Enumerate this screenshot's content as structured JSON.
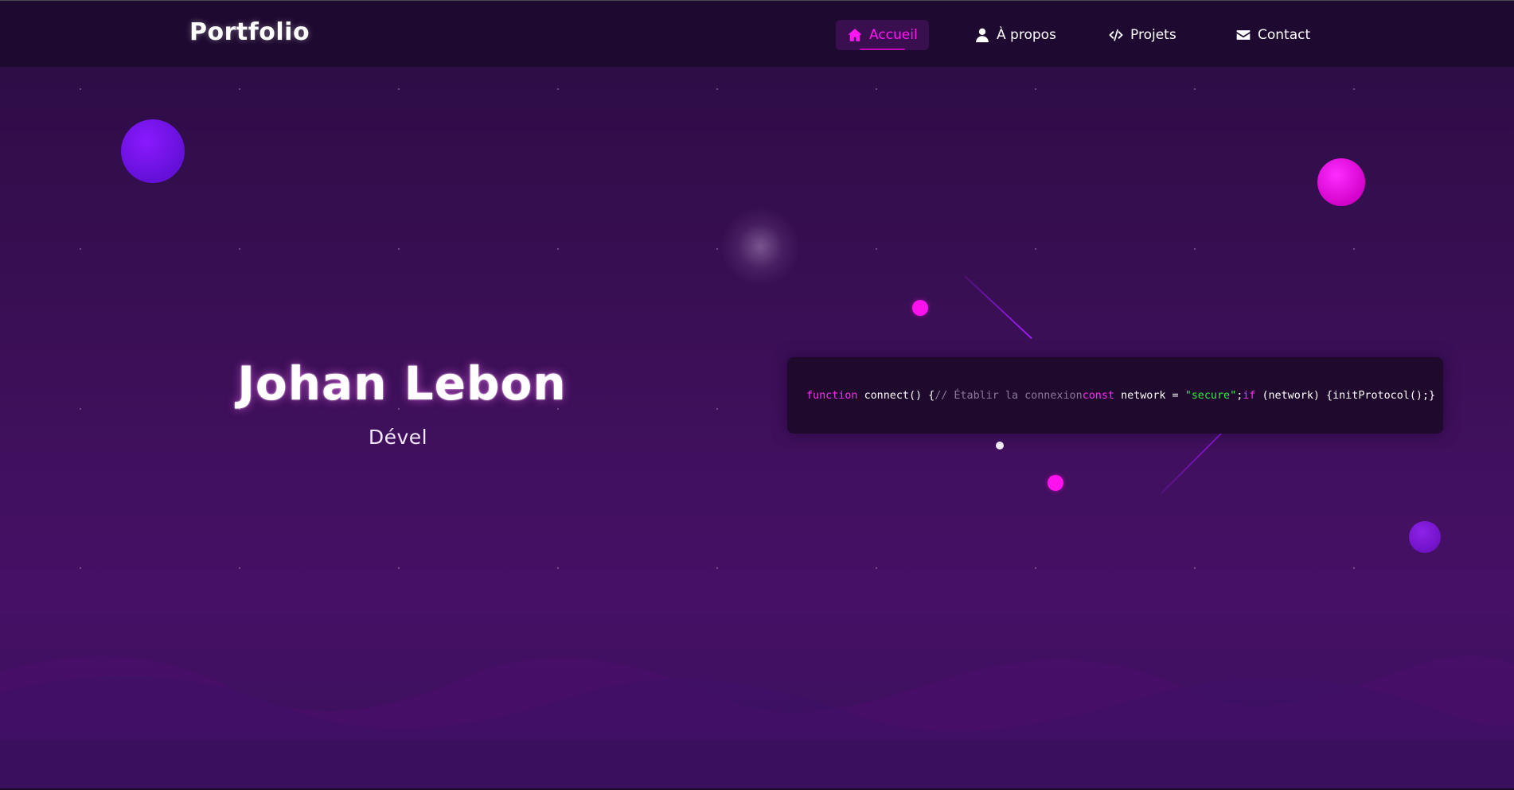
{
  "brand": {
    "logo": "Portfolio"
  },
  "nav": {
    "items": [
      {
        "label": "Accueil",
        "icon": "home-icon",
        "active": true
      },
      {
        "label": "À propos",
        "icon": "user-icon",
        "active": false
      },
      {
        "label": "Projets",
        "icon": "code-icon",
        "active": false
      },
      {
        "label": "Contact",
        "icon": "envelope-icon",
        "active": false
      }
    ]
  },
  "hero": {
    "name": "Johan Lebon",
    "role": "Dével"
  },
  "code": {
    "tokens": [
      {
        "t": "function ",
        "k": "kw"
      },
      {
        "t": "connect() {",
        "k": "plain"
      },
      {
        "t": "// Établir la connexion",
        "k": "cmt"
      },
      {
        "t": "const ",
        "k": "kw"
      },
      {
        "t": "network = ",
        "k": "plain"
      },
      {
        "t": "\"secure\"",
        "k": "str"
      },
      {
        "t": ";",
        "k": "plain"
      },
      {
        "t": "if ",
        "k": "kw"
      },
      {
        "t": "(network) {initProtocol();}",
        "k": "plain"
      }
    ]
  },
  "colors": {
    "accent": "#ff16f0",
    "nav_background": "#1e0a30",
    "page_background": "#3a0f55",
    "code_background": "#1f0a2e",
    "keyword": "#ff2cf0",
    "string": "#2ef03a",
    "comment": "#8a7a98"
  }
}
